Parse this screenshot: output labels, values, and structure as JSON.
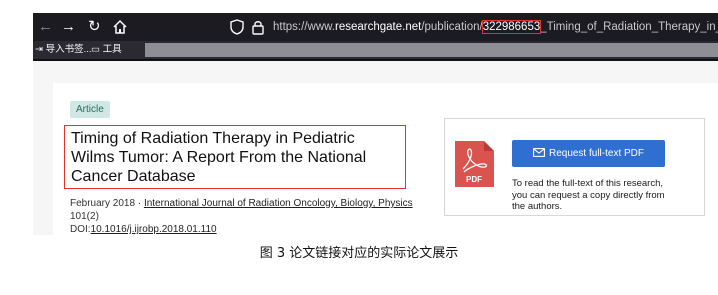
{
  "browser": {
    "url_prefix": "https://www.",
    "url_host": "researchgate.net",
    "url_path": "/publication/",
    "url_id": "322986653",
    "url_rest": "_Timing_of_Radiation_Therapy_in_Pediatri",
    "bookmarks": [
      {
        "label": "导入书签..."
      },
      {
        "label": "工具"
      }
    ]
  },
  "article": {
    "badge": "Article",
    "title": "Timing of Radiation Therapy in Pediatric Wilms Tumor: A Report From the National Cancer Database",
    "date": "February 2018",
    "separator": " · ",
    "journal": "International Journal of Radiation Oncology, Biology, Physics",
    "volume": "101(2)",
    "doi_label": "DOI:",
    "doi": "10.1016/j.ijrobp.2018.01.110"
  },
  "pdf_panel": {
    "icon_label": "PDF",
    "button_label": "Request full-text PDF",
    "note": "To read the full-text of this research, you can request a copy directly from the authors."
  },
  "caption": "图 3   论文链接对应的实际论文展示",
  "colors": {
    "highlight": "#e0342b",
    "button": "#2f6fd1",
    "badge_bg": "#cfe8e3",
    "pdf_icon": "#d9534f"
  }
}
